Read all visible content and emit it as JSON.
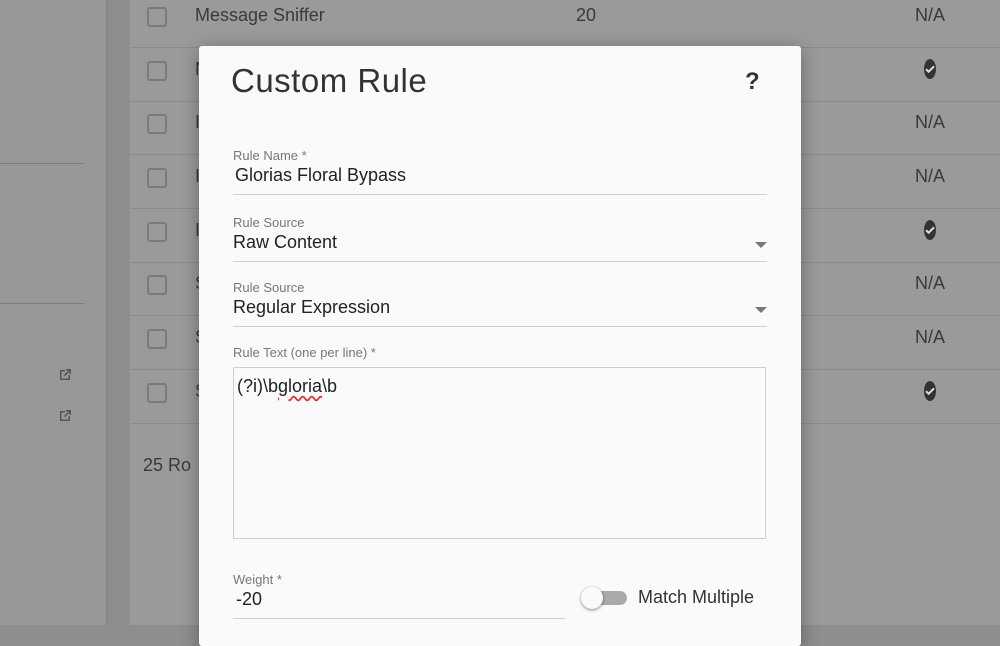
{
  "background_table": {
    "rows": [
      {
        "name": "Message Sniffer",
        "value": "20",
        "status": "N/A"
      },
      {
        "name": "N",
        "value": "",
        "status": "check"
      },
      {
        "name": "I",
        "value": "",
        "status": "N/A"
      },
      {
        "name": "I",
        "value": "",
        "status": "N/A"
      },
      {
        "name": "I",
        "value": "",
        "status": "check"
      },
      {
        "name": "S",
        "value": "",
        "status": "N/A"
      },
      {
        "name": "S",
        "value": "",
        "status": "N/A"
      },
      {
        "name": "S",
        "value": "",
        "status": "check"
      }
    ],
    "footer_text": "25 Ro"
  },
  "modal": {
    "title": "Custom Rule",
    "help": "?",
    "rule_name": {
      "label": "Rule Name *",
      "value": "Glorias Floral Bypass"
    },
    "rule_source_1": {
      "label": "Rule Source",
      "value": "Raw Content"
    },
    "rule_source_2": {
      "label": "Rule Source",
      "value": "Regular Expression"
    },
    "rule_text": {
      "label": "Rule Text (one per line) *",
      "prefix": "(?i)\\b",
      "spell_word": "gloria",
      "suffix": "\\b"
    },
    "weight": {
      "label": "Weight *",
      "value": "-20"
    },
    "match_multiple": {
      "label": "Match Multiple",
      "enabled": false
    }
  },
  "icons": {
    "external_link": "external-link-icon",
    "check": "check-circle-icon",
    "dropdown": "dropdown-arrow-icon"
  }
}
